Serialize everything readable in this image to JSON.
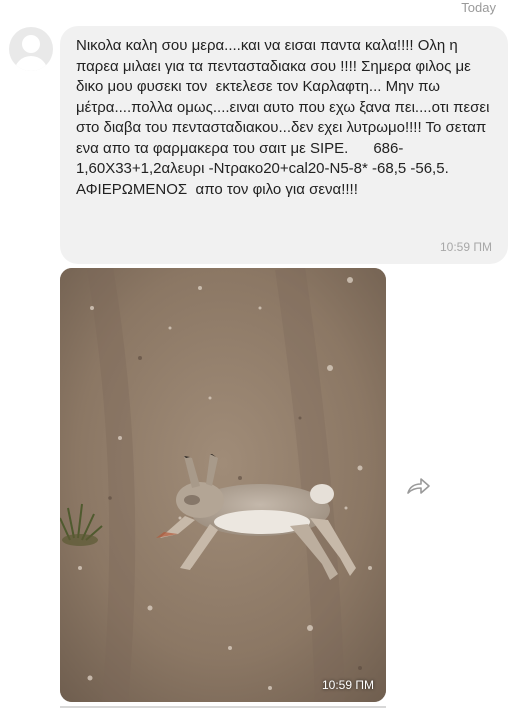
{
  "header": {
    "date_label": "Today"
  },
  "sender": {
    "avatar_icon": "user-avatar-placeholder-icon"
  },
  "messages": [
    {
      "type": "text",
      "text": "Νικολα καλη σου μερα....και να εισαι παντα καλα!!!! Ολη η παρεα μιλαει για τα πεντασταδιακα σου !!!! Σημερα φιλος με δικο μου φυσεκι τον  εκτελεσε τον Καρλαφτη... Μην πω μέτρα....πολλα ομως....ειναι αυτο που εχω ξανα πει....οτι πεσει στο διαβα του πενταστα­διακου...δεν εχει λυτρωμο!!!! Το σεταπ ενα απο τα φαρμακερα του σαιτ με SIPE.      686-1,60Χ33+1,2αλευρι -Ντρακο20+cal20-N5-8* -68,5 -56,5.  ΑΦΙΕΡΩΜΕΝΟΣ  απο τον φιλο για σενα!!!!",
      "time": "10:59 ΠΜ"
    },
    {
      "type": "image",
      "time": "10:59 ΠΜ"
    }
  ],
  "actions": {
    "forward_icon": "forward-share-icon"
  },
  "colors": {
    "bubble_bg": "#f1f1f1",
    "text": "#222222",
    "timestamp": "#a8a8a8"
  }
}
